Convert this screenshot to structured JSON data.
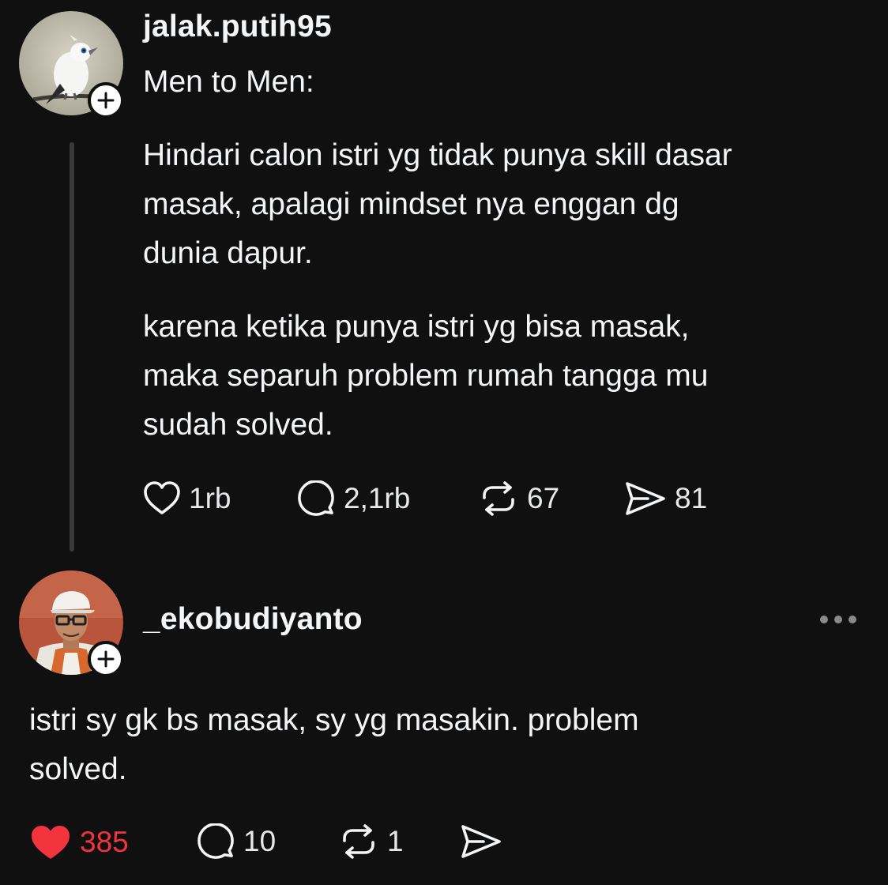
{
  "post": {
    "username": "jalak.putih95",
    "title": "Men to Men:",
    "paragraph1": [
      "Hindari calon istri yg tidak punya skill dasar",
      "masak, apalagi mindset nya enggan dg",
      "dunia dapur."
    ],
    "paragraph2": [
      "karena ketika punya istri yg bisa masak,",
      "maka separuh problem rumah tangga mu",
      "sudah solved."
    ],
    "actions": {
      "likes": "1rb",
      "replies": "2,1rb",
      "reposts": "67",
      "shares": "81"
    }
  },
  "reply": {
    "username": "_ekobudiyanto",
    "text": [
      "istri sy gk bs masak, sy yg masakin. problem",
      "solved."
    ],
    "actions": {
      "likes": "385",
      "replies": "10",
      "reposts": "1"
    },
    "liked": true
  },
  "icons": {
    "follow": "plus-icon",
    "like": "heart-icon",
    "reply": "speech-bubble-icon",
    "repost": "repost-icon",
    "share": "paper-plane-icon",
    "more": "more-options-icon"
  },
  "colors": {
    "background": "#101010",
    "text": "#f3f5f7",
    "liked": "#f2343f",
    "thread_line": "#3a3a3a"
  }
}
